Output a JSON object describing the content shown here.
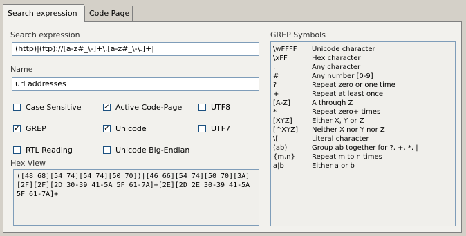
{
  "tabs": [
    {
      "label": "Search expression",
      "active": true
    },
    {
      "label": "Code Page",
      "active": false
    }
  ],
  "search": {
    "label": "Search expression",
    "value": "(http)|(ftp)://[a-z#_\\-]+\\.[a-z#_\\-\\.]+|"
  },
  "name": {
    "label": "Name",
    "value": "url addresses"
  },
  "checkboxes": {
    "case_sensitive": {
      "label": "Case Sensitive",
      "checked": false
    },
    "active_code_page": {
      "label": "Active Code-Page",
      "checked": true
    },
    "utf8": {
      "label": "UTF8",
      "checked": false
    },
    "grep": {
      "label": "GREP",
      "checked": true
    },
    "unicode": {
      "label": "Unicode",
      "checked": true
    },
    "utf7": {
      "label": "UTF7",
      "checked": false
    },
    "rtl_reading": {
      "label": "RTL Reading",
      "checked": false
    },
    "unicode_big_endian": {
      "label": "Unicode Big-Endian",
      "checked": false
    }
  },
  "hex_view": {
    "label": "Hex View",
    "value": "([48 68][54 74][54 74][50 70])|[46 66][54 74][50 70][3A][2F][2F][2D 30-39 41-5A 5F 61-7A]+[2E][2D 2E 30-39 41-5A 5F 61-7A]+"
  },
  "grep_symbols": {
    "label": "GREP Symbols",
    "items": [
      {
        "symbol": "\\wFFFF",
        "desc": "Unicode character"
      },
      {
        "symbol": "\\xFF",
        "desc": "Hex character"
      },
      {
        "symbol": ".",
        "desc": "Any character"
      },
      {
        "symbol": "#",
        "desc": "Any number [0-9]"
      },
      {
        "symbol": "?",
        "desc": "Repeat zero or one time"
      },
      {
        "symbol": "+",
        "desc": "Repeat at least once"
      },
      {
        "symbol": "[A-Z]",
        "desc": "A through Z"
      },
      {
        "symbol": "*",
        "desc": "Repeat zero+ times"
      },
      {
        "symbol": "[XYZ]",
        "desc": "Either X, Y or Z"
      },
      {
        "symbol": "[^XYZ]",
        "desc": "Neither X nor Y nor Z"
      },
      {
        "symbol": "\\[",
        "desc": "Literal character"
      },
      {
        "symbol": "(ab)",
        "desc": "Group ab together for ?, +, *, |"
      },
      {
        "symbol": "{m,n}",
        "desc": "Repeat m to n times"
      },
      {
        "symbol": "a|b",
        "desc": "Either a or b"
      }
    ]
  }
}
